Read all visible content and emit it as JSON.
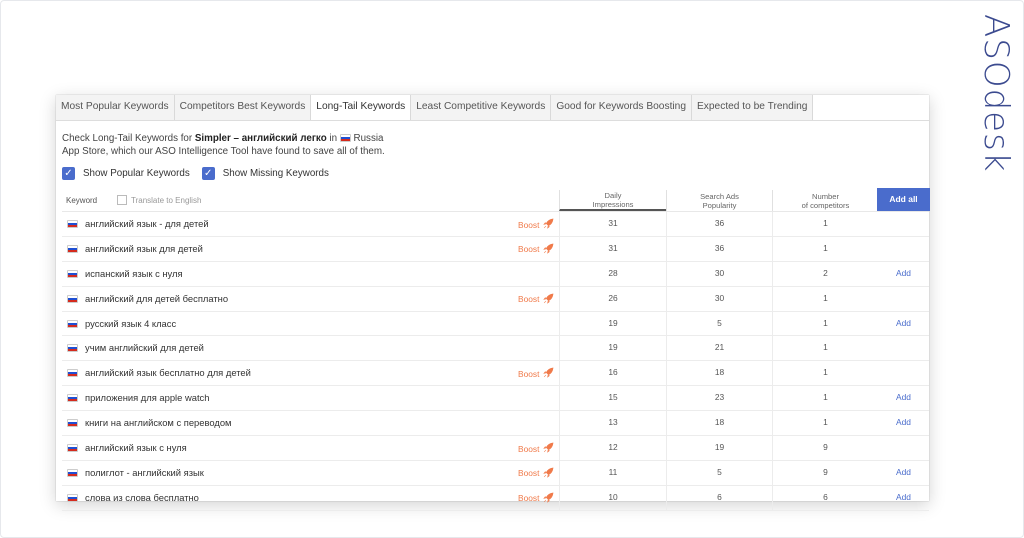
{
  "logo": {
    "text": "ASOdesk"
  },
  "tabs": [
    {
      "label": "Most Popular Keywords",
      "active": false
    },
    {
      "label": "Competitors Best Keywords",
      "active": false
    },
    {
      "label": "Long-Tail Keywords",
      "active": true
    },
    {
      "label": "Least Competitive Keywords",
      "active": false
    },
    {
      "label": "Good for Keywords Boosting",
      "active": false
    },
    {
      "label": "Expected to be Trending",
      "active": false
    }
  ],
  "description": {
    "prefix": "Check Long-Tail Keywords for",
    "app_name": "Simpler – английский легко",
    "in": "in",
    "country": "Russia",
    "suffix": "App Store, which our ASO Intelligence Tool have found to save all of them."
  },
  "checkboxes": {
    "popular": "Show Popular Keywords",
    "missing": "Show Missing Keywords"
  },
  "table": {
    "headers": {
      "keyword": "Keyword",
      "translate": "Translate to English",
      "daily_1": "Daily",
      "daily_2": "Impressions",
      "ads_1": "Search Ads",
      "ads_2": "Popularity",
      "num_1": "Number",
      "num_2": "of competitors",
      "add_all": "Add all"
    },
    "boost_label": "Boost",
    "add_label": "Add",
    "rows": [
      {
        "keyword": "английский язык - для детей",
        "boost": true,
        "daily": "31",
        "ads": "36",
        "competitors": "1",
        "add": false
      },
      {
        "keyword": "английский язык для детей",
        "boost": true,
        "daily": "31",
        "ads": "36",
        "competitors": "1",
        "add": false
      },
      {
        "keyword": "испанский язык с нуля",
        "boost": false,
        "daily": "28",
        "ads": "30",
        "competitors": "2",
        "add": true
      },
      {
        "keyword": "английский для детей бесплатно",
        "boost": true,
        "daily": "26",
        "ads": "30",
        "competitors": "1",
        "add": false
      },
      {
        "keyword": "русский язык 4 класс",
        "boost": false,
        "daily": "19",
        "ads": "5",
        "competitors": "1",
        "add": true
      },
      {
        "keyword": "учим английский для детей",
        "boost": false,
        "daily": "19",
        "ads": "21",
        "competitors": "1",
        "add": false
      },
      {
        "keyword": "английский язык бесплатно для детей",
        "boost": true,
        "daily": "16",
        "ads": "18",
        "competitors": "1",
        "add": false
      },
      {
        "keyword": "приложения для apple watch",
        "boost": false,
        "daily": "15",
        "ads": "23",
        "competitors": "1",
        "add": true
      },
      {
        "keyword": "книги на английском с переводом",
        "boost": false,
        "daily": "13",
        "ads": "18",
        "competitors": "1",
        "add": true
      },
      {
        "keyword": "английский язык с нуля",
        "boost": true,
        "daily": "12",
        "ads": "19",
        "competitors": "9",
        "add": false
      },
      {
        "keyword": "полиглот - английский язык",
        "boost": true,
        "daily": "11",
        "ads": "5",
        "competitors": "9",
        "add": true
      },
      {
        "keyword": "слова из слова бесплатно",
        "boost": true,
        "daily": "10",
        "ads": "6",
        "competitors": "6",
        "add": true
      }
    ]
  },
  "colors": {
    "accent": "#4a6ccc",
    "boost": "#f07a4a",
    "logo": "#3b4a8f"
  }
}
